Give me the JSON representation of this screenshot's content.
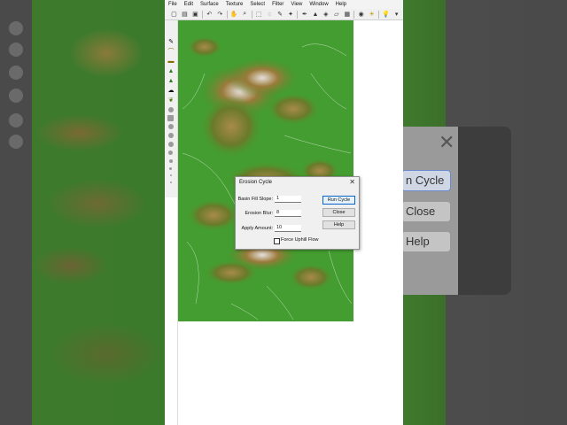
{
  "menu": [
    "File",
    "Edit",
    "Surface",
    "Texture",
    "Select",
    "Filter",
    "View",
    "Window",
    "Help"
  ],
  "dialog": {
    "title": "Erosion Cycle",
    "close_glyph": "✕",
    "fields": [
      {
        "label": "Basin Fill Slope:",
        "value": "1"
      },
      {
        "label": "Erosion Blur:",
        "value": "8"
      },
      {
        "label": "Apply Amount:",
        "value": "10"
      }
    ],
    "buttons": {
      "run": "Run Cycle",
      "close": "Close",
      "help": "Help"
    },
    "checkbox": {
      "label": "Force Uphill Flow",
      "checked": false
    }
  },
  "background_ghost": {
    "close_glyph": "✕",
    "buttons": [
      "n Cycle",
      "Close",
      "Help"
    ]
  },
  "colors": {
    "terrain_low": "#3f9a2e",
    "terrain_mid": "#8a6a2a",
    "terrain_high": "#d8d2cc",
    "button_focus": "#0a64c8"
  }
}
